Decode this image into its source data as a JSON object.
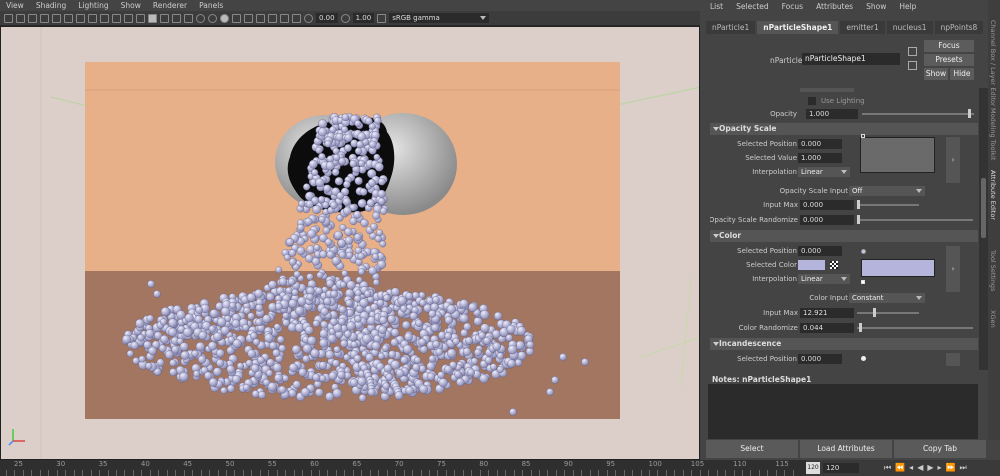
{
  "viewport": {
    "menu": [
      "View",
      "Shading",
      "Lighting",
      "Show",
      "Renderer",
      "Panels"
    ],
    "toolbar": {
      "exposure": "0.00",
      "gamma": "1.00",
      "color_space": "sRGB gamma"
    }
  },
  "attribute_editor": {
    "menu": [
      "List",
      "Selected",
      "Focus",
      "Attributes",
      "Show",
      "Help"
    ],
    "tabs": [
      "nParticle1",
      "nParticleShape1",
      "emitter1",
      "nucleus1",
      "npPoints8"
    ],
    "node_label": "nParticle:",
    "node_name": "nParticleShape1",
    "buttons": {
      "focus": "Focus",
      "presets": "Presets",
      "show": "Show",
      "hide": "Hide"
    },
    "use_lighting": "Use Lighting",
    "opacity": {
      "label": "Opacity",
      "value": "1.000",
      "level": 1.0
    },
    "opacity_scale": {
      "title": "Opacity Scale",
      "selected_position_label": "Selected Position",
      "selected_position": "0.000",
      "selected_value_label": "Selected Value",
      "selected_value": "1.000",
      "interpolation_label": "Interpolation",
      "interpolation": "Linear",
      "input_label": "Opacity Scale Input",
      "input": "Off",
      "input_max_label": "Input Max",
      "input_max": "0.000",
      "randomize_label": "Opacity Scale Randomize",
      "randomize": "0.000"
    },
    "color": {
      "title": "Color",
      "selected_position_label": "Selected Position",
      "selected_position": "0.000",
      "selected_color_label": "Selected Color",
      "swatch": "#b4b4dc",
      "interpolation_label": "Interpolation",
      "interpolation": "Linear",
      "input_label": "Color Input",
      "input": "Constant",
      "input_max_label": "Input Max",
      "input_max": "12.921",
      "randomize_label": "Color Randomize",
      "randomize": "0.044"
    },
    "incandescence": {
      "title": "Incandescence",
      "selected_position_label": "Selected Position",
      "selected_position": "0.000"
    },
    "notes_label": "Notes:  nParticleShape1",
    "bottom_buttons": [
      "Select",
      "Load Attributes",
      "Copy Tab"
    ],
    "side_tabs": [
      "Channel Box / Layer Editor",
      "Modeling Toolkit",
      "Attribute Editor",
      "Tool Settings",
      "XGen"
    ]
  },
  "timeline": {
    "ticks": [
      "25",
      "30",
      "35",
      "40",
      "45",
      "50",
      "55",
      "60",
      "65",
      "70",
      "75",
      "80",
      "85",
      "90",
      "95",
      "100",
      "105",
      "110",
      "115"
    ],
    "current_frame": "120",
    "end_frame": "120"
  },
  "colors": {
    "wall": "#e8b089",
    "floor": "#a37661",
    "particle": "#b4b4dc",
    "canvas_bg": "#dccec8"
  }
}
